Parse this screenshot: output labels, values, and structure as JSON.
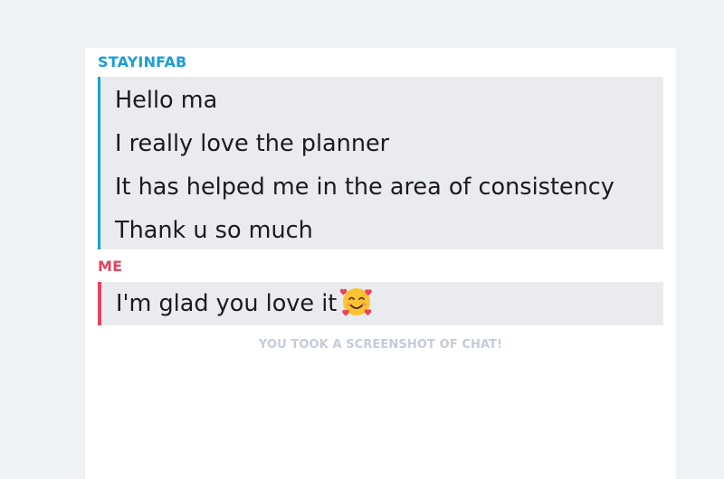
{
  "chat": {
    "other_sender": "STAYINFAB",
    "other_messages": [
      "Hello ma",
      "I really love the planner",
      "It has helped me in the area of consistency",
      "Thank u so much"
    ],
    "my_sender": "ME",
    "my_message": "I'm glad you love it",
    "my_message_emoji": "smiling-face-with-hearts-icon",
    "screenshot_notice": "YOU TOOK A SCREENSHOT OF CHAT!"
  },
  "colors": {
    "other_accent": "#1a9ed8",
    "my_accent": "#e8435e",
    "bubble_bg": "#e9ebee",
    "notice_text": "#c4ccd6"
  }
}
